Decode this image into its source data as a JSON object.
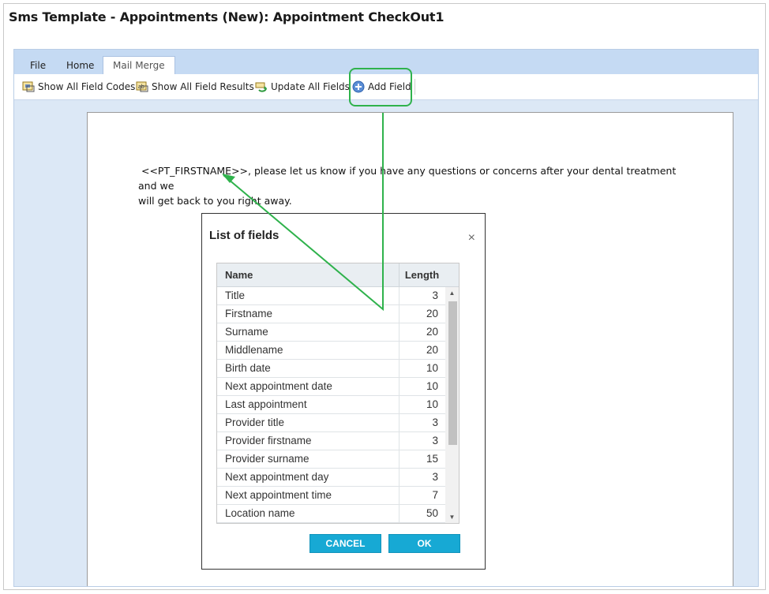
{
  "window": {
    "title": "Sms Template - Appointments (New): Appointment CheckOut1"
  },
  "tabs": [
    {
      "label": "File"
    },
    {
      "label": "Home"
    },
    {
      "label": "Mail Merge"
    }
  ],
  "toolbar": {
    "show_all_field_codes": "Show All Field Codes",
    "show_all_field_results": "Show All Field Results",
    "update_all_fields": "Update All Fields",
    "add_field": "Add Field"
  },
  "document": {
    "field_code": "<<PT_FIRSTNAME>>",
    "text_line1": ", please let us know if you have any questions or concerns after your dental treatment and we",
    "text_line2": "will get back to you right away."
  },
  "dialog": {
    "title": "List of fields",
    "close_glyph": "×",
    "columns": {
      "name": "Name",
      "length": "Length"
    },
    "rows": [
      {
        "name": "Title",
        "length": "3"
      },
      {
        "name": "Firstname",
        "length": "20"
      },
      {
        "name": "Surname",
        "length": "20"
      },
      {
        "name": "Middlename",
        "length": "20"
      },
      {
        "name": "Birth date",
        "length": "10"
      },
      {
        "name": "Next appointment date",
        "length": "10"
      },
      {
        "name": "Last appointment",
        "length": "10"
      },
      {
        "name": "Provider title",
        "length": "3"
      },
      {
        "name": "Provider firstname",
        "length": "3"
      },
      {
        "name": "Provider surname",
        "length": "15"
      },
      {
        "name": "Next appointment day",
        "length": "3"
      },
      {
        "name": "Next appointment time",
        "length": "7"
      },
      {
        "name": "Location name",
        "length": "50"
      }
    ],
    "cancel_label": "CANCEL",
    "ok_label": "OK"
  },
  "colors": {
    "accent_button": "#17a9d4",
    "annotation": "#2fb24c",
    "ribbon": "#c5daf3"
  }
}
